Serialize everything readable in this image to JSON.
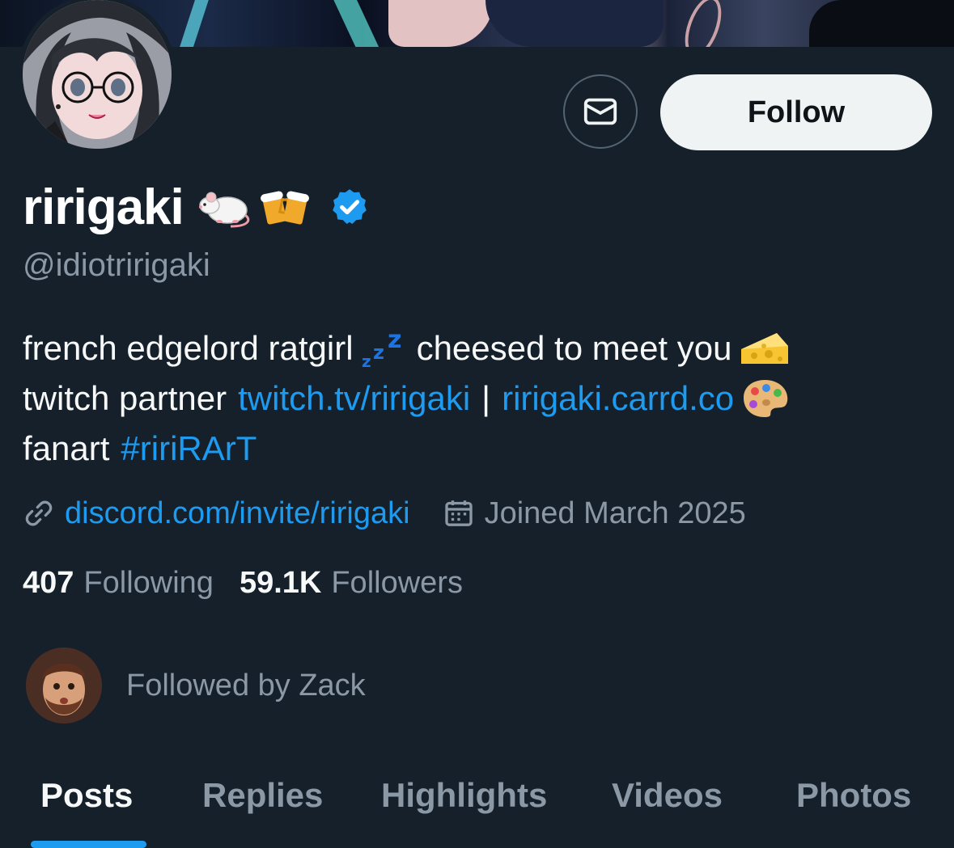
{
  "profile": {
    "display_name": "ririgaki",
    "handle": "@idiotririgaki",
    "verified": true,
    "accent_color": "#1d9bf0",
    "name_emojis": [
      "rat-emoji",
      "beer-mugs-emoji"
    ]
  },
  "actions": {
    "follow_label": "Follow",
    "message_icon": "envelope-icon"
  },
  "bio": {
    "line1_text": "french edgelord ratgirl",
    "line1_emoji": "zzz-emoji",
    "line1_rest": "cheesed to meet you",
    "line1_end_emoji": "cheese-emoji",
    "line2_prefix": "twitch partner",
    "line2_link1": "twitch.tv/ririgaki",
    "line2_sep": "|",
    "line2_link2": "ririgaki.carrd.co",
    "line2_end_emoji": "palette-emoji",
    "line3_prefix": "fanart",
    "line3_hashtag": "#ririRArT"
  },
  "meta": {
    "website": "discord.com/invite/ririgaki",
    "joined": "Joined March 2025"
  },
  "stats": {
    "following_count": "407",
    "following_label": "Following",
    "followers_count": "59.1K",
    "followers_label": "Followers"
  },
  "followed_by": {
    "text": "Followed by Zack"
  },
  "tabs": [
    {
      "label": "Posts",
      "active": true
    },
    {
      "label": "Replies",
      "active": false
    },
    {
      "label": "Highlights",
      "active": false
    },
    {
      "label": "Videos",
      "active": false
    },
    {
      "label": "Photos",
      "active": false
    }
  ]
}
